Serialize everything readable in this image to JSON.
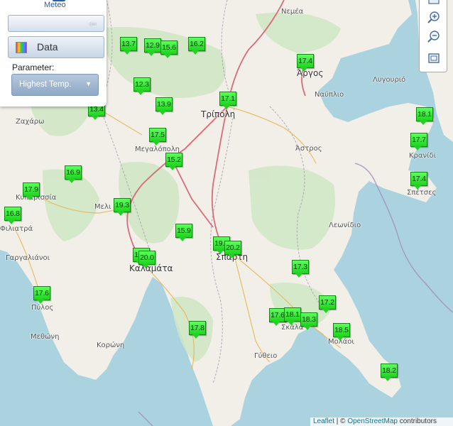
{
  "panel": {
    "logo_text": "Meteo",
    "data_button_label": "Data",
    "parameter_label": "Parameter:",
    "parameter_value": "Highest Temp."
  },
  "attribution": {
    "leaflet": "Leaflet",
    "separator": " | © ",
    "osm": "OpenStreetMap",
    "suffix": " contributors"
  },
  "places": [
    {
      "name": "Νεμέα",
      "city": false
    },
    {
      "name": "Άργος",
      "city": true
    },
    {
      "name": "Ναύπλιο",
      "city": false
    },
    {
      "name": "Λυγουριό",
      "city": false
    },
    {
      "name": "Τρίπολη",
      "city": true
    },
    {
      "name": "Ζαχάρω",
      "city": false
    },
    {
      "name": "Μεγαλόπολη",
      "city": false
    },
    {
      "name": "Άστρος",
      "city": false
    },
    {
      "name": "Κρανίδι",
      "city": false
    },
    {
      "name": "Σπέτσες",
      "city": false
    },
    {
      "name": "Κυπαρισσία",
      "city": false
    },
    {
      "name": "Μελι",
      "city": false
    },
    {
      "name": "Φιλιατρά",
      "city": false
    },
    {
      "name": "Λεωνίδιο",
      "city": false
    },
    {
      "name": "Γαργαλιάνοι",
      "city": false
    },
    {
      "name": "Καλαμάτα",
      "city": true
    },
    {
      "name": "Σπάρτη",
      "city": true
    },
    {
      "name": "Πύλος",
      "city": false
    },
    {
      "name": "Μεθώνη",
      "city": false
    },
    {
      "name": "Κορώνη",
      "city": false
    },
    {
      "name": "Σκάλα",
      "city": false
    },
    {
      "name": "Μολάοι",
      "city": false
    },
    {
      "name": "Γύθειο",
      "city": false
    }
  ],
  "stations": [
    {
      "value": "13.7"
    },
    {
      "value": "12.9"
    },
    {
      "value": "15.6"
    },
    {
      "value": "16.2"
    },
    {
      "value": "17.4"
    },
    {
      "value": "12.3"
    },
    {
      "value": "13.9"
    },
    {
      "value": "17.1"
    },
    {
      "value": "13.4"
    },
    {
      "value": "18.1"
    },
    {
      "value": "17.5"
    },
    {
      "value": "17.7"
    },
    {
      "value": "15.2"
    },
    {
      "value": "16.9"
    },
    {
      "value": "17.4"
    },
    {
      "value": "17.9"
    },
    {
      "value": "19.3"
    },
    {
      "value": "16.8"
    },
    {
      "value": "15.9"
    },
    {
      "value": "19.1"
    },
    {
      "value": "20.2"
    },
    {
      "value": "19.5"
    },
    {
      "value": "20.0"
    },
    {
      "value": "17.3"
    },
    {
      "value": "17.6"
    },
    {
      "value": "17.2"
    },
    {
      "value": "17.6"
    },
    {
      "value": "18.1"
    },
    {
      "value": "18.3"
    },
    {
      "value": "17.8"
    },
    {
      "value": "18.5"
    },
    {
      "value": "18.2"
    }
  ]
}
